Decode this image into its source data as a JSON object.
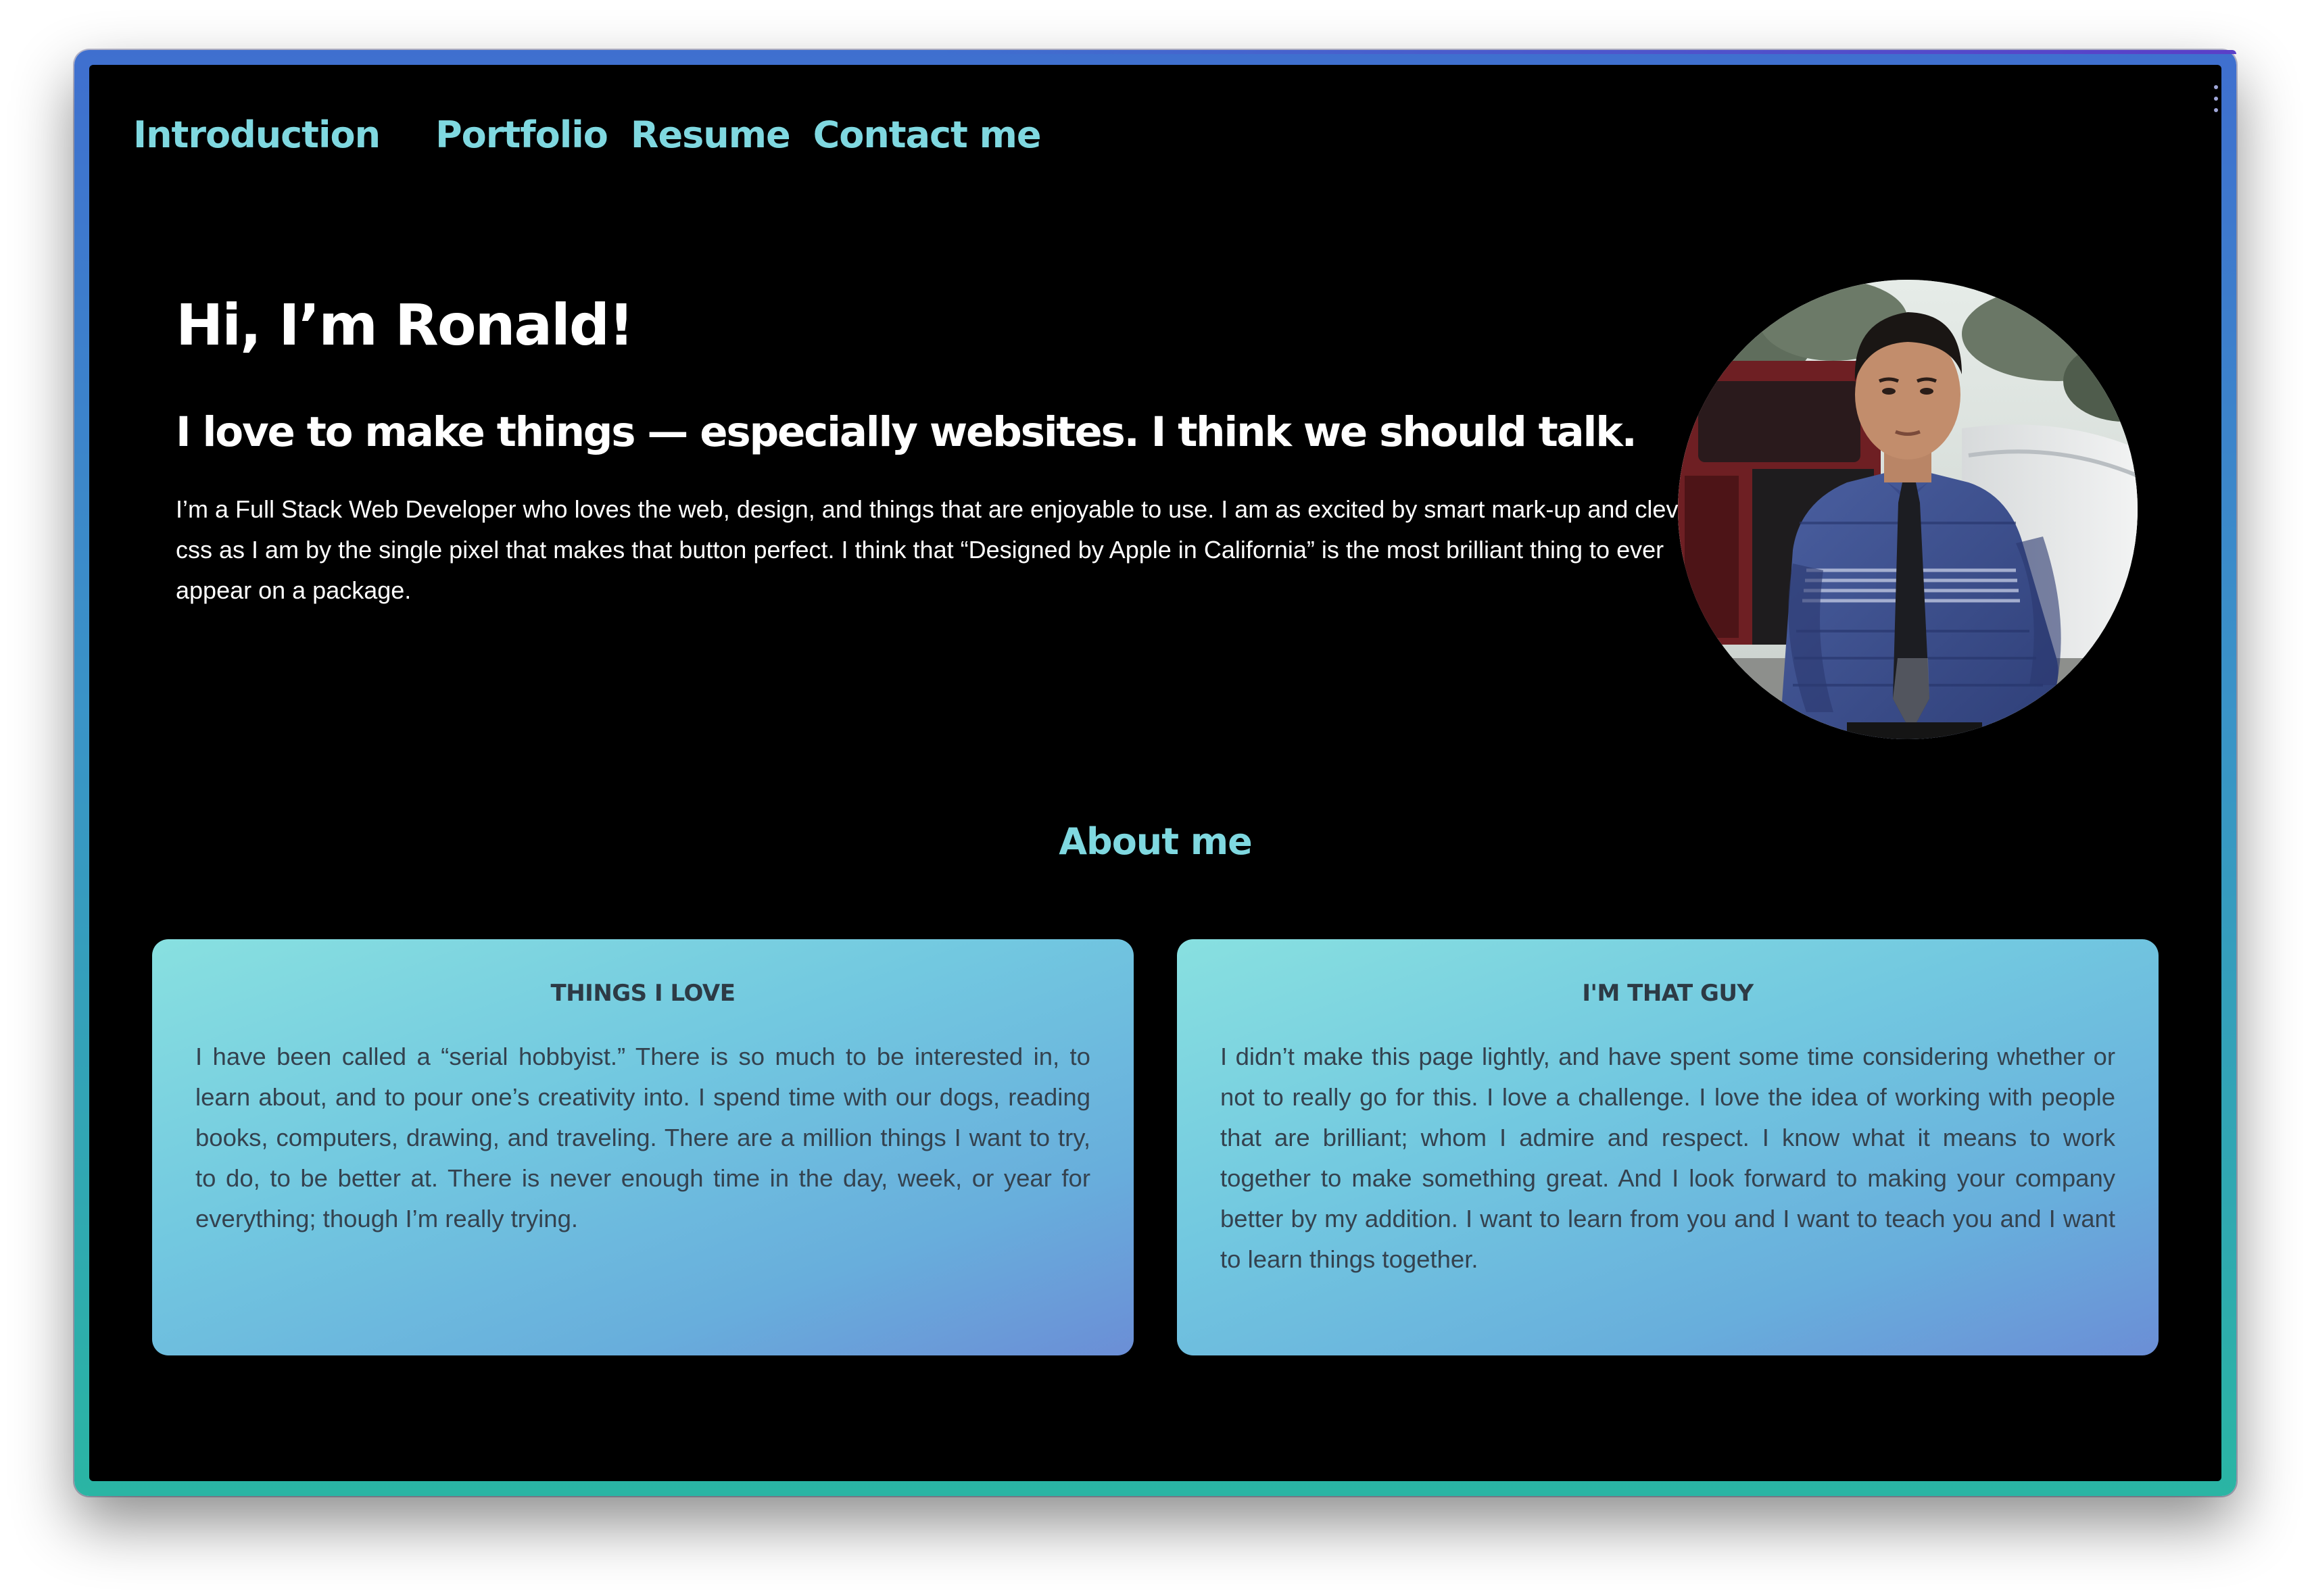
{
  "nav": {
    "items": [
      {
        "label": "Introduction"
      },
      {
        "label": "Portfolio"
      },
      {
        "label": "Resume"
      },
      {
        "label": "Contact me"
      }
    ]
  },
  "hero": {
    "title": "Hi, I’m Ronald!",
    "subtitle": "I love to make things — especially websites. I think we should talk.",
    "body": "I’m a Full Stack Web Developer who loves the web, design, and things that are enjoyable to use. I am as excited by smart mark-up and clever css as I am by the single pixel that makes that button perfect. I think that “Designed by Apple in California” is the most brilliant thing to ever appear on a package."
  },
  "about": {
    "heading": "About me",
    "cards": [
      {
        "title": "THINGS I LOVE",
        "text": "I have been called a “serial hobbyist.” There is so much to be interested in, to learn about, and to pour one’s creativity into. I spend time with our dogs, reading books, computers, drawing, and traveling. There are a million things I want to try, to do, to be better at. There is never enough time in the day, week, or year for everything; though I’m really trying."
      },
      {
        "title": "I'M THAT GUY",
        "text": "I didn’t make this page lightly, and have spent some time considering whether or not to really go for this. I love a challenge. I love the idea of working with people that are brilliant; whom I admire and respect. I know what it means to work together to make something great. And I look forward to making your company better by my addition. I want to learn from you and I want to teach you and I want to learn things together."
      }
    ]
  },
  "colors": {
    "accent": "#7fd8e0",
    "background": "#000000",
    "card_gradient_start": "#88e0e0",
    "card_gradient_end": "#6b8ed6",
    "frame_top": "#3f6fcf",
    "frame_bottom": "#2ab5a4"
  }
}
